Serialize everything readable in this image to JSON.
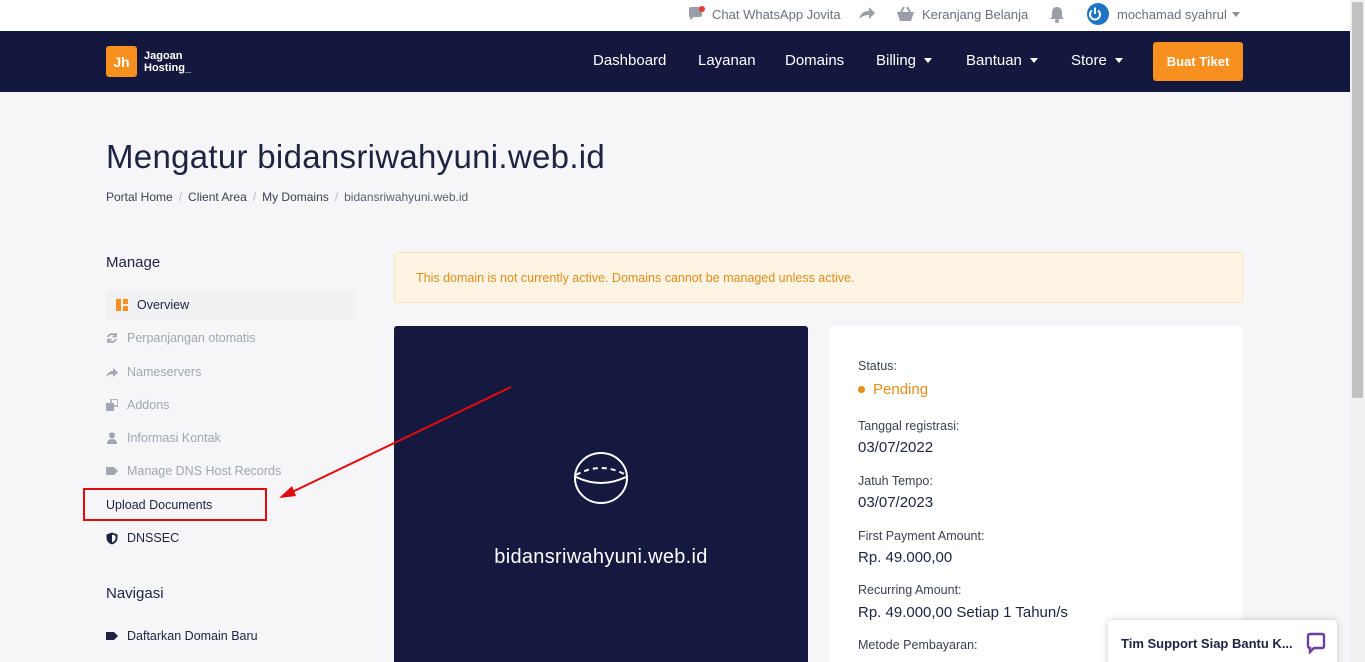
{
  "topbar": {
    "chat_label": "Chat WhatsApp Jovita",
    "cart_label": "Keranjang Belanja",
    "user_name": "mochamad syahrul"
  },
  "navbar": {
    "logo_line1": "Jagoan",
    "logo_line2": "Hosting_",
    "logo_mark": "Jh",
    "links": [
      "Dashboard",
      "Layanan",
      "Domains",
      "Billing",
      "Bantuan",
      "Store"
    ],
    "ticket_button": "Buat Tiket"
  },
  "page": {
    "title": "Mengatur bidansriwahyuni.web.id",
    "breadcrumb": [
      "Portal Home",
      "Client Area",
      "My Domains",
      "bidansriwahyuni.web.id"
    ]
  },
  "sidebar": {
    "manage_heading": "Manage",
    "manage_items": [
      "Overview",
      "Perpanjangan otomatis",
      "Nameservers",
      "Addons",
      "Informasi Kontak",
      "Manage DNS Host Records",
      "Upload Documents",
      "DNSSEC"
    ],
    "nav_heading": "Navigasi",
    "nav_items": [
      "Daftarkan Domain Baru"
    ]
  },
  "alert": {
    "message": "This domain is not currently active. Domains cannot be managed unless active."
  },
  "domain_card": {
    "domain": "bidansriwahyuni.web.id"
  },
  "info": {
    "status_label": "Status:",
    "status_value": "Pending",
    "reg_label": "Tanggal registrasi:",
    "reg_value": "03/07/2022",
    "due_label": "Jatuh Tempo:",
    "due_value": "03/07/2023",
    "first_label": "First Payment Amount:",
    "first_value": "Rp. 49.000,00",
    "recurring_label": "Recurring Amount:",
    "recurring_value": "Rp. 49.000,00 Setiap 1 Tahun/s",
    "method_label": "Metode Pembayaran:"
  },
  "chat_widget": {
    "label": "Tim Support Siap Bantu K..."
  },
  "colors": {
    "navy": "#14183f",
    "orange": "#f7901e",
    "pending": "#e38d18",
    "annotation_red": "#e10b0b"
  }
}
